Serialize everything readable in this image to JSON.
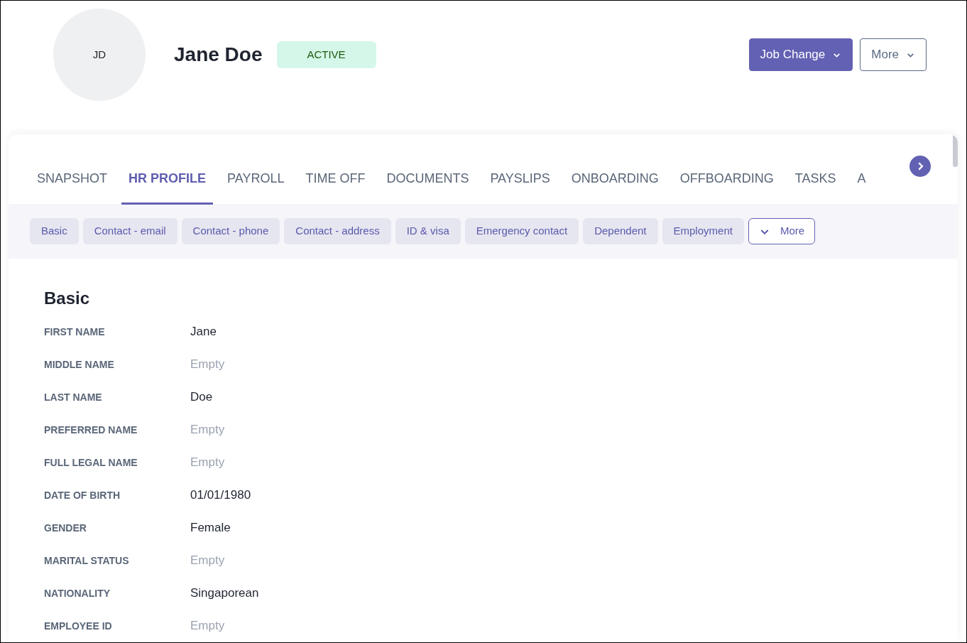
{
  "header": {
    "avatar_initials": "JD",
    "name": "Jane Doe",
    "status": "ACTIVE",
    "buttons": [
      {
        "label": "Job Change",
        "kind": "primary"
      },
      {
        "label": "More",
        "kind": "outline"
      }
    ]
  },
  "tabs": [
    {
      "label": "SNAPSHOT",
      "selected": false
    },
    {
      "label": "HR PROFILE",
      "selected": true
    },
    {
      "label": "PAYROLL",
      "selected": false
    },
    {
      "label": "TIME OFF",
      "selected": false
    },
    {
      "label": "DOCUMENTS",
      "selected": false
    },
    {
      "label": "PAYSLIPS",
      "selected": false
    },
    {
      "label": "ONBOARDING",
      "selected": false
    },
    {
      "label": "OFFBOARDING",
      "selected": false
    },
    {
      "label": "TASKS",
      "selected": false
    },
    {
      "label": "A",
      "selected": false
    }
  ],
  "sections": [
    "Basic",
    "Contact - email",
    "Contact - phone",
    "Contact - address",
    "ID & visa",
    "Emergency contact",
    "Dependent",
    "Employment"
  ],
  "sections_more": "More",
  "section_title": "Basic",
  "fields": [
    {
      "label": "FIRST NAME",
      "value": "Jane",
      "empty": false
    },
    {
      "label": "MIDDLE NAME",
      "value": "Empty",
      "empty": true
    },
    {
      "label": "LAST NAME",
      "value": "Doe",
      "empty": false
    },
    {
      "label": "PREFERRED NAME",
      "value": "Empty",
      "empty": true
    },
    {
      "label": "FULL LEGAL NAME",
      "value": "Empty",
      "empty": true
    },
    {
      "label": "DATE OF BIRTH",
      "value": "01/01/1980",
      "empty": false
    },
    {
      "label": "GENDER",
      "value": "Female",
      "empty": false
    },
    {
      "label": "MARITAL STATUS",
      "value": "Empty",
      "empty": true
    },
    {
      "label": "NATIONALITY",
      "value": "Singaporean",
      "empty": false
    },
    {
      "label": "EMPLOYEE ID",
      "value": "Empty",
      "empty": true
    }
  ]
}
